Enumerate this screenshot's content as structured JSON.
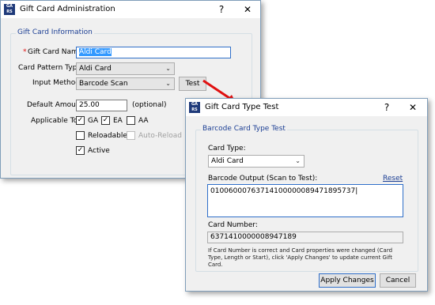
{
  "admin": {
    "title": "Gift Card Administration",
    "help": "?",
    "close": "✕",
    "group_label": "Gift Card Information",
    "required_mark": "*",
    "name_label": "Gift Card Name:",
    "name_value": "Aldi Card",
    "pattern_label": "Card Pattern Type:",
    "pattern_value": "Aldi Card",
    "input_method_label": "Input Method:",
    "input_method_value": "Barcode Scan",
    "test_button": "Test",
    "default_amount_label": "Default Amount:",
    "default_amount_value": "25.00",
    "optional_text": "(optional)",
    "applicable_label": "Applicable To:",
    "checks": {
      "ga": "GA",
      "ea": "EA",
      "aa": "AA",
      "reloadable": "Reloadable",
      "auto_reload": "Auto-Reload",
      "active": "Active"
    },
    "check_mark": "✓"
  },
  "test": {
    "title": "Gift Card Type Test",
    "help": "?",
    "close": "✕",
    "group_label": "Barcode Card Type Test",
    "card_type_label": "Card Type:",
    "card_type_value": "Aldi Card",
    "barcode_label": "Barcode Output (Scan to Test):",
    "reset_link": "Reset",
    "barcode_value": "01006000763714100000089471895737",
    "card_number_label": "Card Number:",
    "card_number_value": "6371410000008947189",
    "note": "If Card Number is correct and Card properties were changed (Card Type, Length or Start), click 'Apply Changes' to update current Gift Card.",
    "apply_button": "Apply Changes",
    "cancel_button": "Cancel"
  },
  "colors": {
    "accent": "#1c3f94",
    "arrow": "#e01010",
    "selection": "#3399ff"
  },
  "icons": {
    "dropdown": "chevron-down-icon",
    "app": "app-icon",
    "arrow": "red-arrow"
  }
}
